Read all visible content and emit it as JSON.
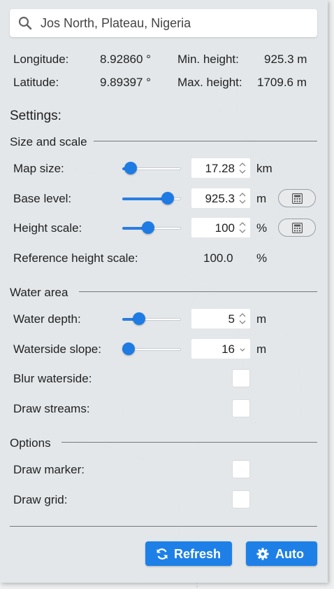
{
  "search": {
    "value": "Jos North, Plateau, Nigeria",
    "icon": "search-icon"
  },
  "coords": {
    "longitude_label": "Longitude:",
    "longitude_value": "8.92860 °",
    "latitude_label": "Latitude:",
    "latitude_value": "9.89397 °",
    "min_height_label": "Min. height:",
    "min_height_value": "925.3 m",
    "max_height_label": "Max. height:",
    "max_height_value": "1709.6 m"
  },
  "settings_heading": "Settings:",
  "size_scale": {
    "title": "Size and scale",
    "map_size": {
      "label": "Map size:",
      "value": "17.28",
      "unit": "km",
      "slider_fraction": 0.05
    },
    "base_level": {
      "label": "Base level:",
      "value": "925.3",
      "unit": "m",
      "slider_fraction": 0.85
    },
    "height_scale": {
      "label": "Height scale:",
      "value": "100",
      "unit": "%",
      "slider_fraction": 0.42
    },
    "reference": {
      "label": "Reference height scale:",
      "value": "100.0",
      "unit": "%"
    }
  },
  "water": {
    "title": "Water area",
    "depth": {
      "label": "Water depth:",
      "value": "5",
      "unit": "m",
      "slider_fraction": 0.22
    },
    "slope": {
      "label": "Waterside slope:",
      "value": "16",
      "unit": "m",
      "slider_fraction": 0.0
    },
    "blur_label": "Blur waterside:",
    "streams_label": "Draw streams:"
  },
  "options": {
    "title": "Options",
    "marker_label": "Draw marker:",
    "grid_label": "Draw grid:"
  },
  "buttons": {
    "refresh": "Refresh",
    "auto": "Auto"
  },
  "colors": {
    "accent": "#1e80e6",
    "panel": "#e2e6ea"
  }
}
